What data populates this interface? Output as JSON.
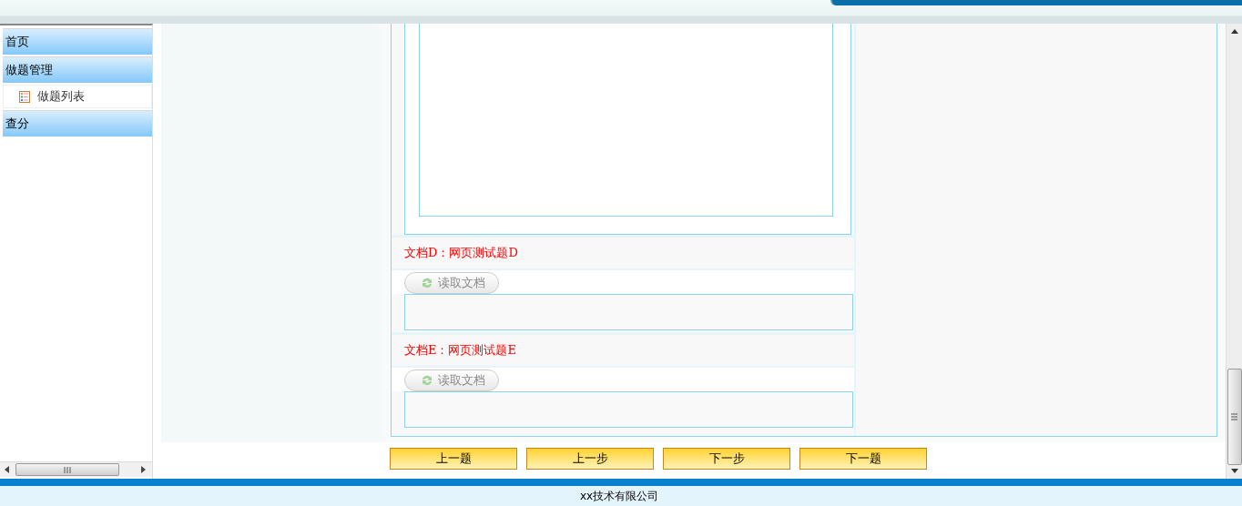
{
  "sidebar": {
    "items": [
      {
        "label": "首页",
        "kind": "header"
      },
      {
        "label": "做题管理",
        "kind": "header",
        "children": [
          {
            "label": "做题列表",
            "kind": "item"
          }
        ]
      },
      {
        "label": "查分",
        "kind": "header"
      }
    ]
  },
  "documents": [
    {
      "title": "文档D：网页测试题D",
      "button": {
        "label": "读取文档",
        "disabled": true
      }
    },
    {
      "title": "文档E：网页测试题E",
      "button": {
        "label": "读取文档",
        "disabled": true
      }
    }
  ],
  "nav_buttons": [
    "上一题",
    "上一步",
    "下一步",
    "下一题"
  ],
  "footer": {
    "text": "xx技术有限公司"
  }
}
